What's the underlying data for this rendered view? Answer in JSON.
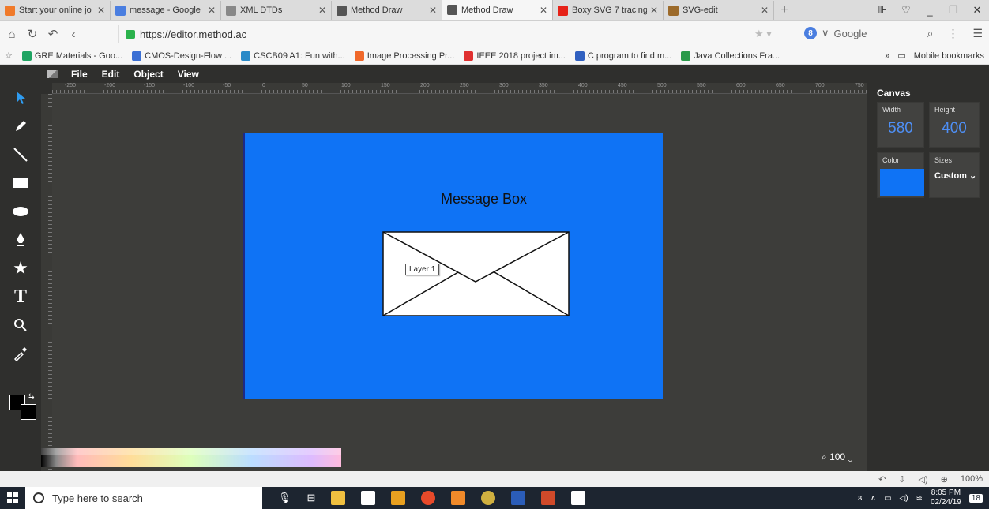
{
  "browser": {
    "tabs": [
      {
        "title": "Start your online jo",
        "fav_color": "#f07a2a"
      },
      {
        "title": "message - Google",
        "fav_color": "#4a7ee0"
      },
      {
        "title": "XML DTDs",
        "fav_color": "#888888"
      },
      {
        "title": "Method Draw",
        "fav_color": "#555555"
      },
      {
        "title": "Method Draw",
        "fav_color": "#555555"
      },
      {
        "title": "Boxy SVG 7 tracing",
        "fav_color": "#e62117"
      },
      {
        "title": "SVG-edit",
        "fav_color": "#9c6a2a"
      }
    ],
    "url": "https://editor.method.ac",
    "search_engine": "Google",
    "bookmarks": [
      {
        "label": "GRE Materials - Goo...",
        "color": "#1fa463"
      },
      {
        "label": "CMOS-Design-Flow ...",
        "color": "#3b6fd4"
      },
      {
        "label": "CSCB09 A1: Fun with...",
        "color": "#2a8ac8"
      },
      {
        "label": "Image Processing Pr...",
        "color": "#f0682a"
      },
      {
        "label": "IEEE 2018 project im...",
        "color": "#e03030"
      },
      {
        "label": "C program to find m...",
        "color": "#3060c0"
      },
      {
        "label": "Java Collections Fra...",
        "color": "#2a9a4a"
      }
    ],
    "mobile_bookmarks": "Mobile bookmarks"
  },
  "app": {
    "menu": [
      "File",
      "Edit",
      "Object",
      "View"
    ],
    "ruler_labels": [
      "-250",
      "-200",
      "-150",
      "-100",
      "-50",
      "0",
      "50",
      "100",
      "150",
      "200",
      "250",
      "300",
      "350",
      "400",
      "450",
      "500",
      "550",
      "600",
      "650",
      "700",
      "750",
      "800"
    ],
    "canvas_text": "Message Box",
    "layer_tooltip": "Layer 1",
    "zoom": "100",
    "canvas_color": "#0f73f5"
  },
  "panel": {
    "title": "Canvas",
    "width_label": "Width",
    "width_value": "580",
    "height_label": "Height",
    "height_value": "400",
    "color_label": "Color",
    "sizes_label": "Sizes",
    "sizes_value": "Custom"
  },
  "status": {
    "zoom_pct": "100%"
  },
  "taskbar": {
    "search_placeholder": "Type here to search",
    "time": "8:05 PM",
    "date": "02/24/19",
    "notif_count": "18"
  }
}
